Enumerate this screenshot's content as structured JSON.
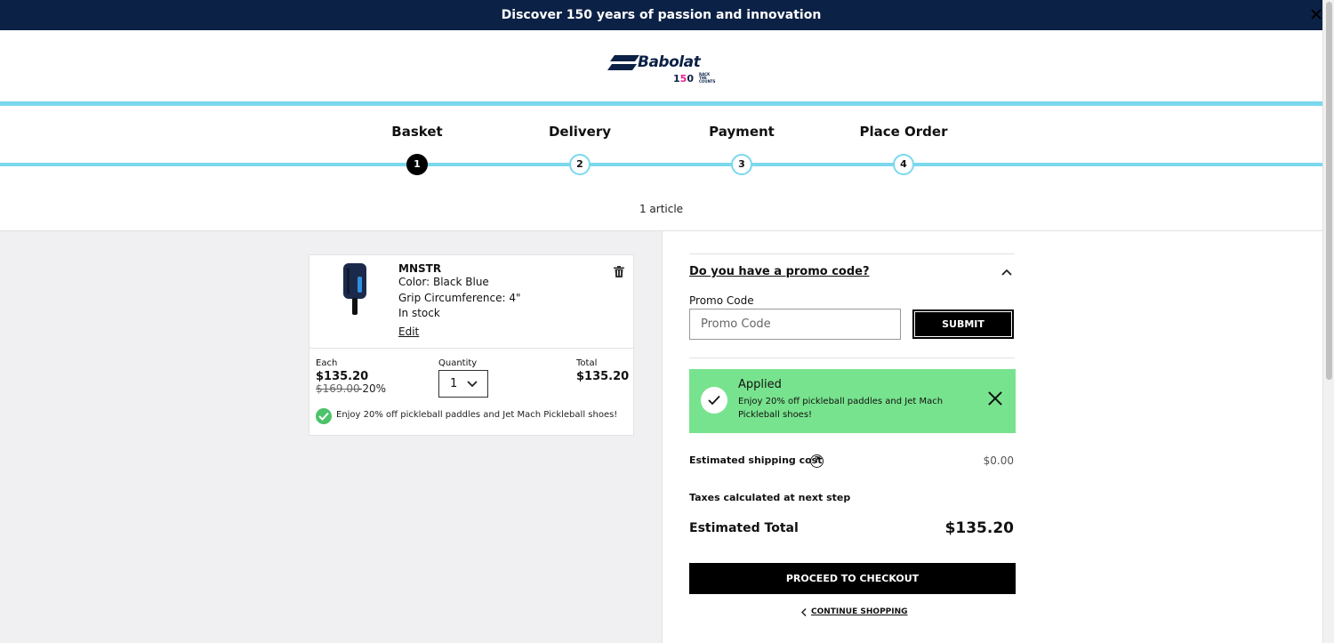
{
  "banner": {
    "text": "Discover 150 years of passion and innovation"
  },
  "logo": {
    "brand": "Babolat",
    "sub_pre": "1",
    "sub_hl": "5",
    "sub_post": "0",
    "tagline": "RACK THE COUNTS"
  },
  "steps": [
    {
      "label": "Basket",
      "number": "1",
      "active": true
    },
    {
      "label": "Delivery",
      "number": "2",
      "active": false
    },
    {
      "label": "Payment",
      "number": "3",
      "active": false
    },
    {
      "label": "Place Order",
      "number": "4",
      "active": false
    }
  ],
  "basket": {
    "article_count": "1 article"
  },
  "product": {
    "name": "MNSTR",
    "color": "Color: Black Blue",
    "grip": "Grip Circumference: 4\"",
    "stock": "In stock",
    "edit_label": "Edit",
    "each_label": "Each",
    "each_price": "$135.20",
    "old_price": "$169.00",
    "discount": "-20%",
    "quantity_label": "Quantity",
    "quantity": "1",
    "total_label": "Total",
    "total_price": "$135.20",
    "promo_message": "Enjoy 20% off pickleball paddles and Jet Mach Pickleball shoes!"
  },
  "promo": {
    "heading": "Do you have a promo code?",
    "label": "Promo Code",
    "placeholder": "Promo Code",
    "submit_label": "SUBMIT",
    "applied_title": "Applied",
    "applied_desc": "Enjoy 20% off pickleball paddles and Jet Mach Pickleball shoes!"
  },
  "summary": {
    "shipping_label": "Estimated shipping cost",
    "shipping_value": "$0.00",
    "tax_note": "Taxes calculated at next step",
    "total_label": "Estimated Total",
    "total_value": "$135.20",
    "checkout_label": "PROCEED TO CHECKOUT",
    "continue_label": "CONTINUE SHOPPING"
  },
  "colors": {
    "navy": "#0c2146",
    "cyan": "#7ad8ee",
    "success_green": "#78e38e",
    "check_green": "#4cc36b"
  }
}
